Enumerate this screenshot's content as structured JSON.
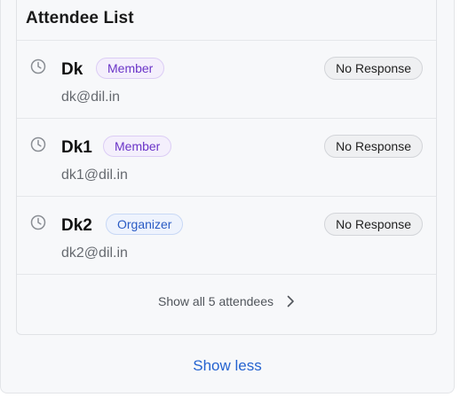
{
  "card": {
    "title": "Attendee List"
  },
  "attendees": [
    {
      "name": "Dk",
      "role": "Member",
      "email": "dk@dil.in",
      "status": "No Response"
    },
    {
      "name": "Dk1",
      "role": "Member",
      "email": "dk1@dil.in",
      "status": "No Response"
    },
    {
      "name": "Dk2",
      "role": "Organizer",
      "email": "dk2@dil.in",
      "status": "No Response"
    }
  ],
  "show_all_label": "Show all 5 attendees",
  "show_less_label": "Show less",
  "icons": {
    "status": "clock-icon",
    "expand": "chevron-right-icon"
  },
  "colors": {
    "member_text": "#6b35c8",
    "organizer_text": "#2a5bc4",
    "link": "#2563d0"
  }
}
